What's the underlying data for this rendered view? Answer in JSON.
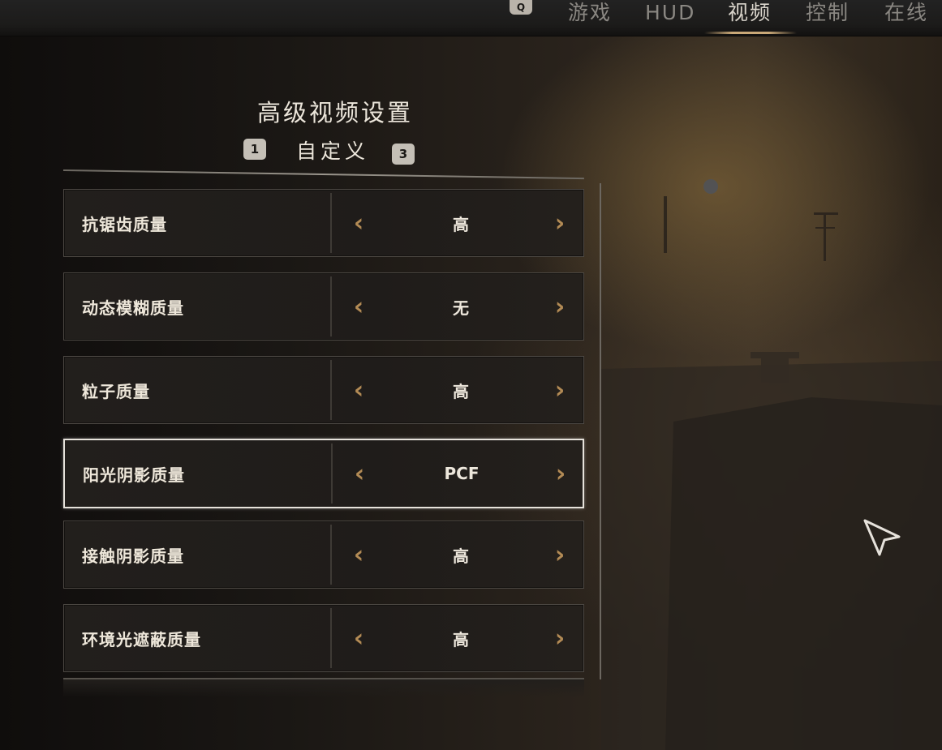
{
  "topbar": {
    "key_hint": "Q",
    "tabs": [
      {
        "label": "游戏",
        "active": false
      },
      {
        "label": "HUD",
        "active": false
      },
      {
        "label": "视频",
        "active": true
      },
      {
        "label": "控制",
        "active": false
      },
      {
        "label": "在线",
        "active": false
      }
    ]
  },
  "header": {
    "title": "高级视频设置",
    "preset_label": "自定义",
    "prev_key": "1",
    "next_key": "3"
  },
  "settings": [
    {
      "label": "抗锯齿质量",
      "value": "高",
      "selected": false
    },
    {
      "label": "动态模糊质量",
      "value": "无",
      "selected": false
    },
    {
      "label": "粒子质量",
      "value": "高",
      "selected": false
    },
    {
      "label": "阳光阴影质量",
      "value": "PCF",
      "selected": true
    },
    {
      "label": "接触阴影质量",
      "value": "高",
      "selected": false
    },
    {
      "label": "环境光遮蔽质量",
      "value": "高",
      "selected": false
    }
  ],
  "glyphs": {
    "left": "‹",
    "right": "›"
  },
  "colors": {
    "accent": "#b38b55",
    "text": "#eee7da",
    "selected_border": "#e6e2db"
  }
}
